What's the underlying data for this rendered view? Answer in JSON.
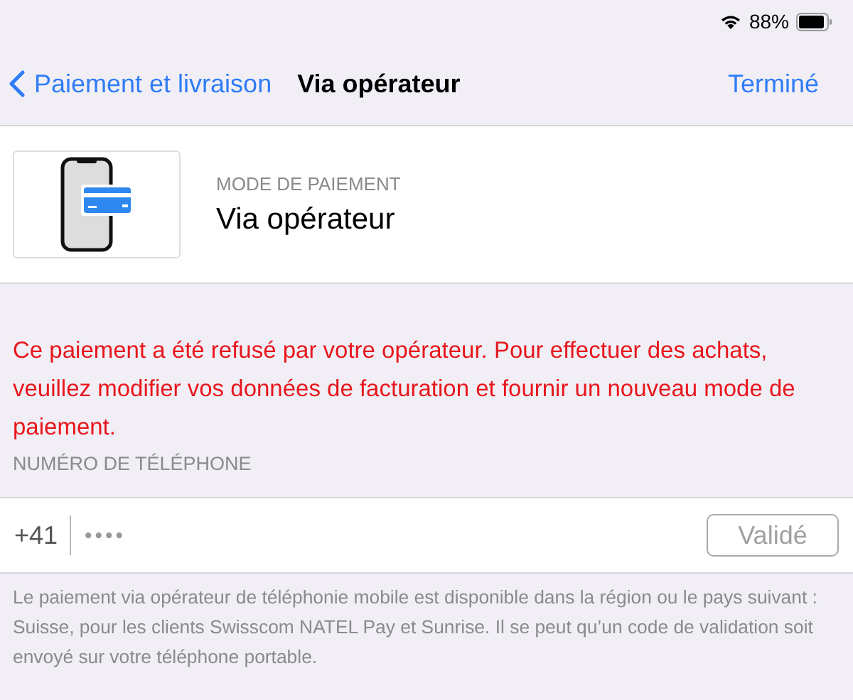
{
  "status_bar": {
    "battery_text": "88%"
  },
  "nav": {
    "back": "Paiement et livraison",
    "title": "Via opérateur",
    "done": "Terminé"
  },
  "payment": {
    "label": "MODE DE PAIEMENT",
    "value": "Via opérateur"
  },
  "error": "Ce paiement a été refusé par votre opérateur. Pour effectuer des achats, veuillez modifier vos données de facturation et fournir un nouveau mode de paiement.",
  "phone": {
    "section": "NUMÉRO DE TÉLÉPHONE",
    "prefix": "+41",
    "value": "••••",
    "button": "Validé",
    "button_disabled": true
  },
  "footnote": "Le paiement via opérateur de téléphonie mobile est disponible dans la région ou le pays suivant : Suisse, pour les clients Swisscom NATEL Pay et Sunrise. Il se peut qu’un code de validation soit envoyé sur votre téléphone portable."
}
